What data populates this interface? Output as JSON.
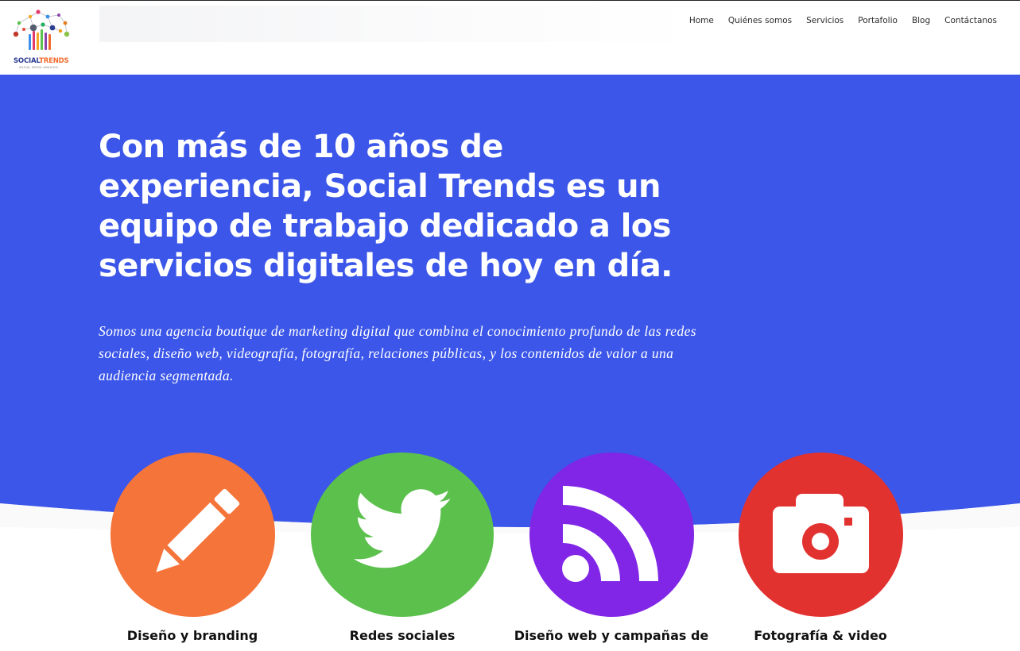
{
  "header": {
    "logo": {
      "name_part1": "SOCIAL",
      "name_part2": "TRENDS",
      "tagline": "SOCIAL MEDIA ANALYSIS"
    },
    "nav": [
      {
        "label": "Home"
      },
      {
        "label": "Quiénes somos"
      },
      {
        "label": "Servicios"
      },
      {
        "label": "Portafolio"
      },
      {
        "label": "Blog"
      },
      {
        "label": "Contáctanos"
      }
    ]
  },
  "hero": {
    "title": "Con más de 10 años de experiencia, Social Trends es un equipo de trabajo dedicado a los servicios digitales de hoy en día.",
    "subtitle": "Somos una agencia boutique de marketing digital que combina el conocimiento profundo de las redes sociales, diseño web, videografía, fotografía, relaciones públicas, y los contenidos de valor a una audiencia segmentada.",
    "background_color": "#3b56e8"
  },
  "services": [
    {
      "label": "Diseño y branding",
      "icon": "pencil-icon",
      "color": "#f5743a"
    },
    {
      "label": "Redes sociales",
      "icon": "twitter-bird-icon",
      "color": "#5cc04d"
    },
    {
      "label": "Diseño web y campañas de",
      "icon": "rss-icon",
      "color": "#8126e6"
    },
    {
      "label": "Fotografía & video",
      "icon": "camera-icon",
      "color": "#e23230"
    }
  ]
}
